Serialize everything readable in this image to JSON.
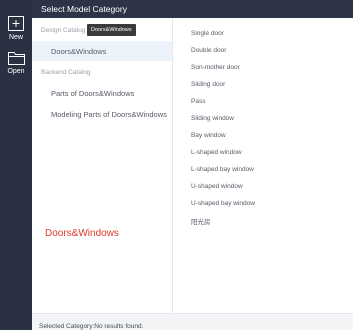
{
  "sidebar": {
    "new_label": "New",
    "open_label": "Open"
  },
  "dialog": {
    "title": "Select Model Category",
    "tooltip": "Doors&Windows",
    "sections": [
      {
        "label": "Design Catalog",
        "items": [
          "Doors&Windows"
        ]
      },
      {
        "label": "Backend Catalog",
        "items": [
          "Parts of Doors&Windows",
          "Modeling Parts of Doors&Windows"
        ]
      }
    ],
    "selected_label": "Doors&Windows",
    "subcategories": [
      "Single door",
      "Double door",
      "Son-mother door",
      "Sliding door",
      "Pass",
      "Sliding window",
      "Bay window",
      "L-shaped window",
      "L-shaped bay window",
      "U-shaped window",
      "U-shaped bay window",
      "阳光房"
    ],
    "status": "Selected Category:No results found."
  },
  "colors": {
    "sidebar_bg": "#2a3142",
    "selected_bg": "#edf3fb",
    "highlight_text": "#e0392b"
  }
}
